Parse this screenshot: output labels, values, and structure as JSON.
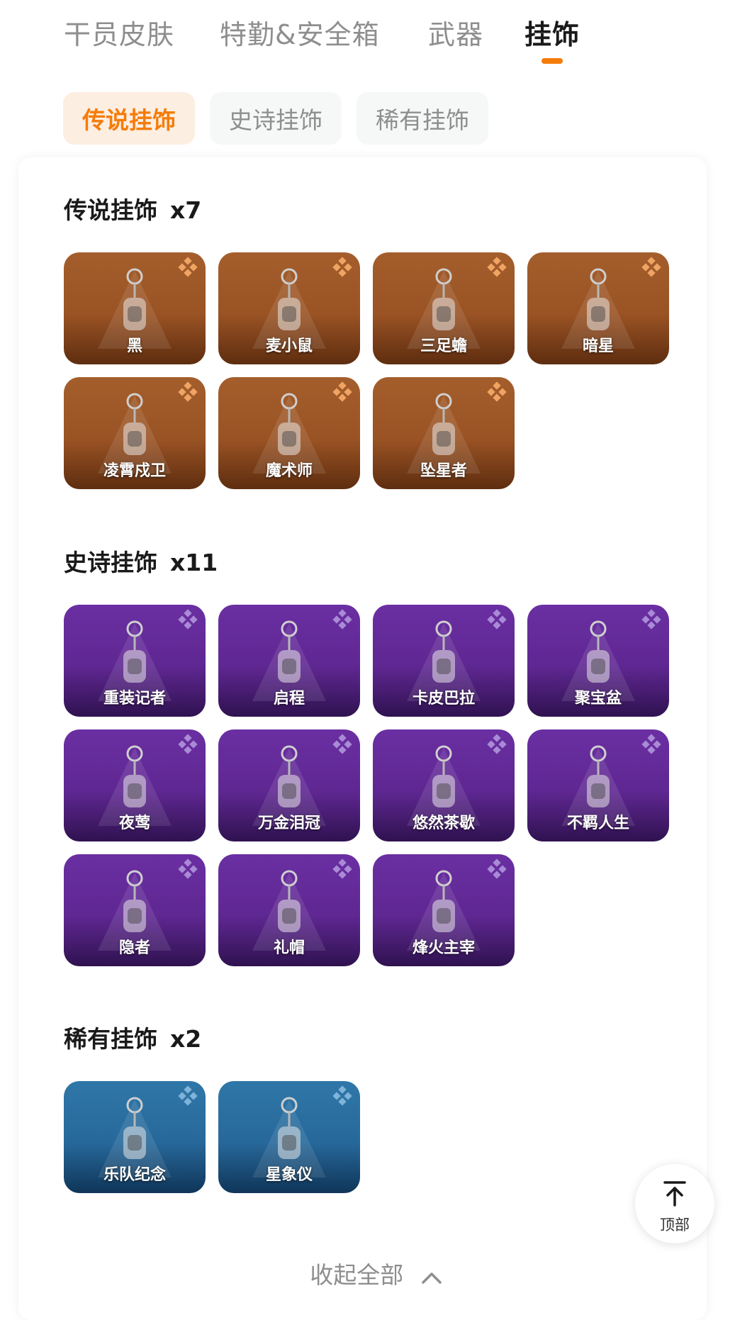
{
  "tabs": [
    {
      "label": "干员皮肤",
      "active": false
    },
    {
      "label": "特勤&安全箱",
      "active": false
    },
    {
      "label": "武器",
      "active": false
    },
    {
      "label": "挂饰",
      "active": true
    }
  ],
  "sub_tabs": [
    {
      "label": "传说挂饰",
      "active": true
    },
    {
      "label": "史诗挂饰",
      "active": false
    },
    {
      "label": "稀有挂饰",
      "active": false
    }
  ],
  "sections": [
    {
      "title": "传说挂饰",
      "count": "x7",
      "rarity": "legend",
      "items": [
        "黑",
        "麦小鼠",
        "三足蟾",
        "暗星",
        "凌霄戍卫",
        "魔术师",
        "坠星者"
      ]
    },
    {
      "title": "史诗挂饰",
      "count": "x11",
      "rarity": "epic",
      "items": [
        "重装记者",
        "启程",
        "卡皮巴拉",
        "聚宝盆",
        "夜莺",
        "万金泪冠",
        "悠然茶歇",
        "不羁人生",
        "隐者",
        "礼帽",
        "烽火主宰"
      ]
    },
    {
      "title": "稀有挂饰",
      "count": "x2",
      "rarity": "rare",
      "items": [
        "乐队纪念",
        "星象仪"
      ]
    }
  ],
  "collapse_label": "收起全部",
  "back_to_top_label": "顶部",
  "colors": {
    "accent": "#f57c0a",
    "legend": "#9a5324",
    "epic": "#5f2792",
    "rare": "#27689a",
    "legend_icon": "#f0a463",
    "epic_icon": "#a98ad6",
    "rare_icon": "#7fb3d9"
  },
  "icons": {
    "rarity": "diamond-cluster-icon",
    "charm": "keychain-charm-icon",
    "collapse": "chevron-up-icon",
    "back_to_top": "arrow-up-to-line-icon"
  }
}
